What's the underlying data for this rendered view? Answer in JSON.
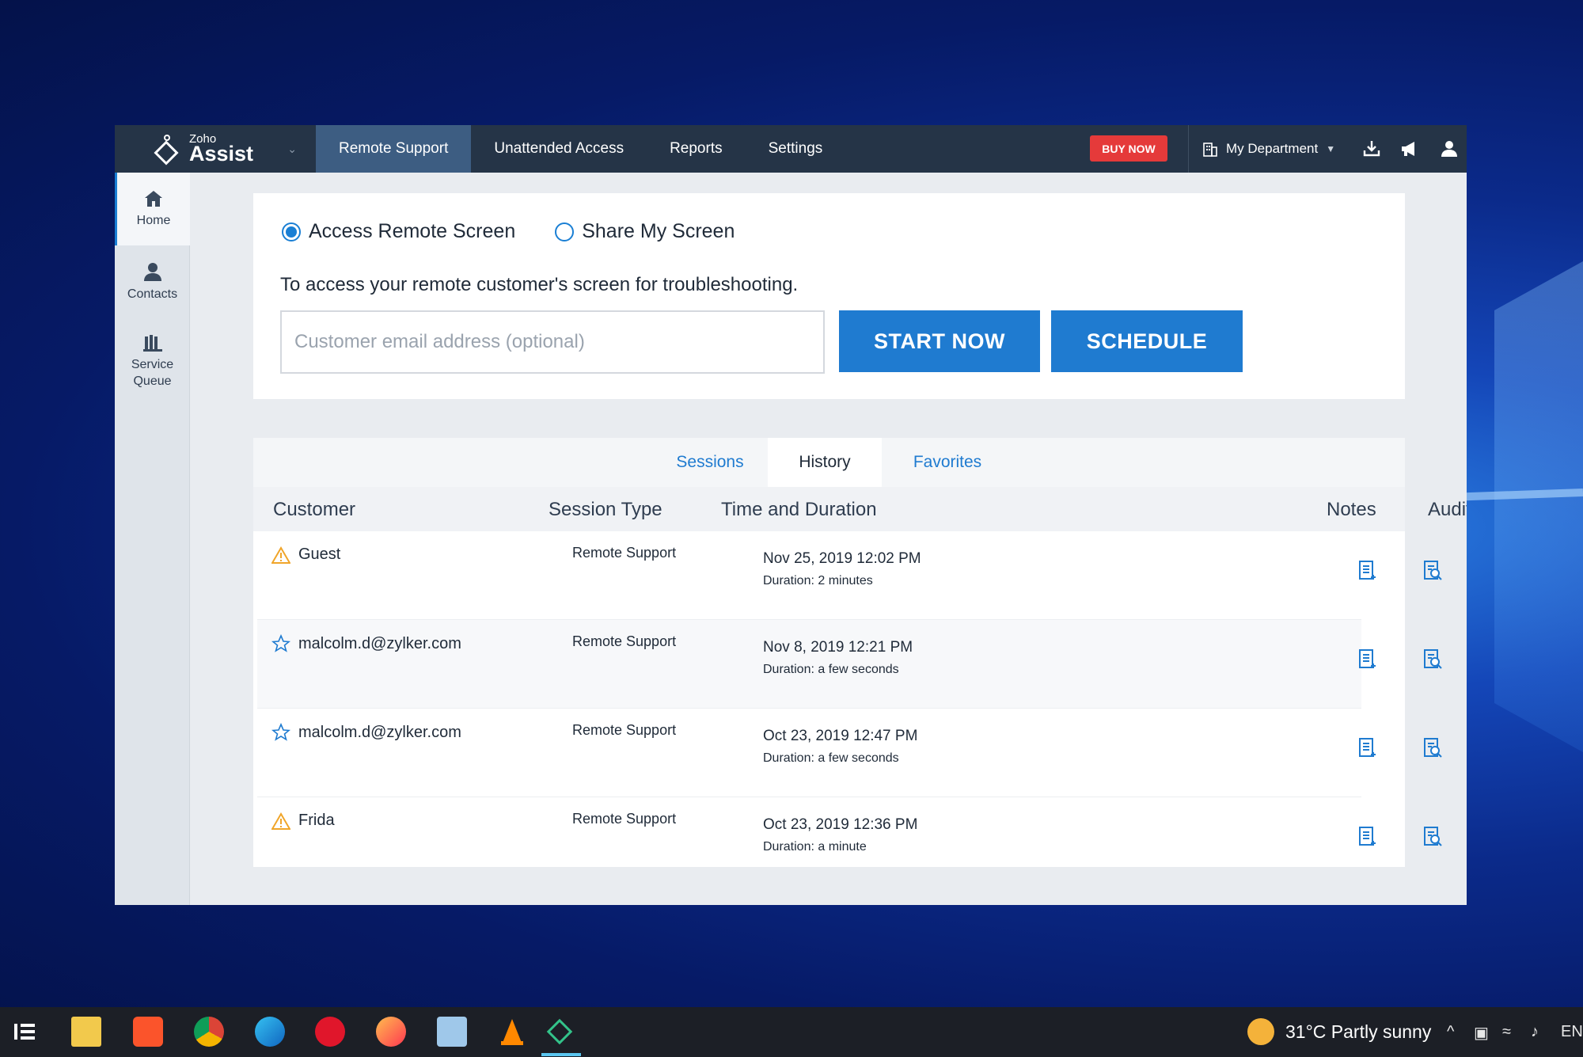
{
  "topbar": {
    "brand_small": "Zoho",
    "brand_big": "Assist",
    "nav": [
      "Remote Support",
      "Unattended Access",
      "Reports",
      "Settings"
    ],
    "buy_now": "BUY NOW",
    "department": "My Department"
  },
  "sidebar": {
    "items": [
      {
        "label": "Home",
        "icon": "home-icon"
      },
      {
        "label": "Contacts",
        "icon": "contacts-icon"
      },
      {
        "label": "Service\nQueue",
        "icon": "service-queue-icon"
      }
    ]
  },
  "session": {
    "option_access": "Access Remote Screen",
    "option_share": "Share My Screen",
    "description": "To access your remote customer's screen for troubleshooting.",
    "email_placeholder": "Customer email address (optional)",
    "start_now": "START NOW",
    "schedule": "SCHEDULE"
  },
  "tabs": [
    "Sessions",
    "History",
    "Favorites"
  ],
  "table": {
    "headers": [
      "Customer",
      "Session Type",
      "Time and Duration",
      "Notes",
      "Audit"
    ],
    "rows": [
      {
        "customer": "Guest",
        "type": "Remote Support",
        "time": "Nov 25, 2019 12:02 PM",
        "duration": "Duration: 2 minutes",
        "icon": "warning-icon"
      },
      {
        "customer": "malcolm.d@zylker.com",
        "type": "Remote Support",
        "time": "Nov 8, 2019 12:21 PM",
        "duration": "Duration: a few seconds",
        "icon": "star-icon"
      },
      {
        "customer": "malcolm.d@zylker.com",
        "type": "Remote Support",
        "time": "Oct 23, 2019 12:47 PM",
        "duration": "Duration: a few seconds",
        "icon": "star-icon"
      },
      {
        "customer": "Frida",
        "type": "Remote Support",
        "time": "Oct 23, 2019 12:36 PM",
        "duration": "Duration: a minute",
        "icon": "warning-icon"
      }
    ]
  },
  "taskbar": {
    "weather": "31°C  Partly sunny",
    "lang": "EN"
  },
  "colors": {
    "accent": "#1f7bd0",
    "topbar": "#253447",
    "buy": "#e53a3a"
  }
}
